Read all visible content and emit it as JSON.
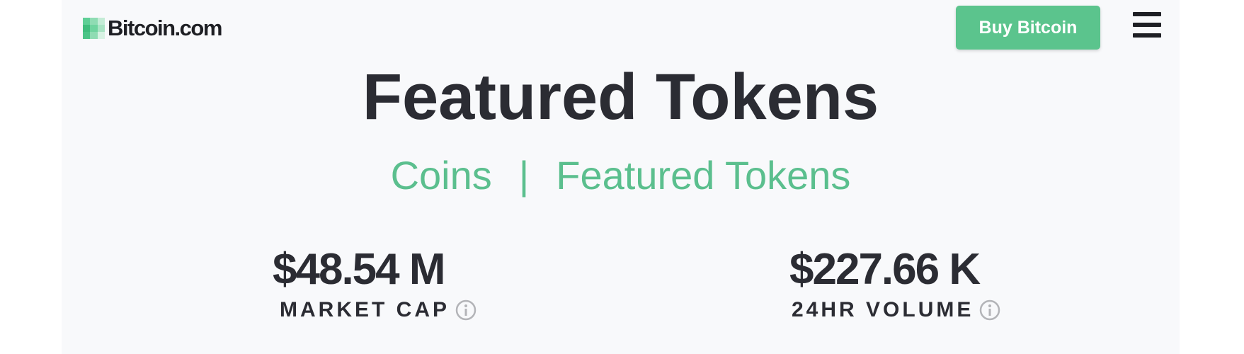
{
  "header": {
    "logo_text": "Bitcoin.com",
    "buy_button_label": "Buy Bitcoin",
    "menu_icon": "hamburger-menu-icon"
  },
  "title": "Featured Tokens",
  "subnav": {
    "items": [
      {
        "label": "Coins"
      },
      {
        "label": "Featured Tokens"
      }
    ],
    "separator": "|"
  },
  "stats": {
    "market_cap": {
      "value": "$48.54 M",
      "label": "MARKET CAP",
      "icon": "info-icon"
    },
    "volume_24h": {
      "value": "$227.66 K",
      "label": "24HR VOLUME",
      "icon": "info-icon"
    }
  },
  "colors": {
    "accent_green": "#5bbf8e",
    "button_green": "#5bc48d",
    "text_dark": "#2b2c33",
    "background": "#f8f9fb"
  }
}
